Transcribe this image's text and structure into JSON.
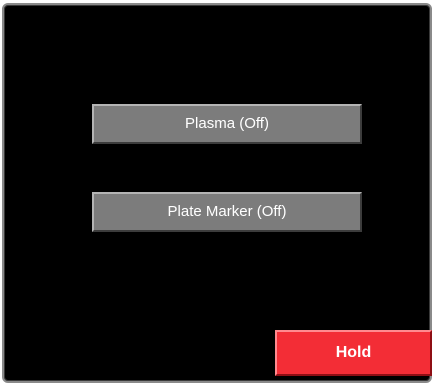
{
  "panel": {
    "buttons": {
      "plasma_label": "Plasma (Off)",
      "plate_marker_label": "Plate Marker (Off)",
      "hold_label": "Hold"
    }
  },
  "colors": {
    "panel_background": "#000000",
    "button_gray": "#7c7c7c",
    "hold_red": "#f32d36",
    "text": "#ffffff"
  }
}
